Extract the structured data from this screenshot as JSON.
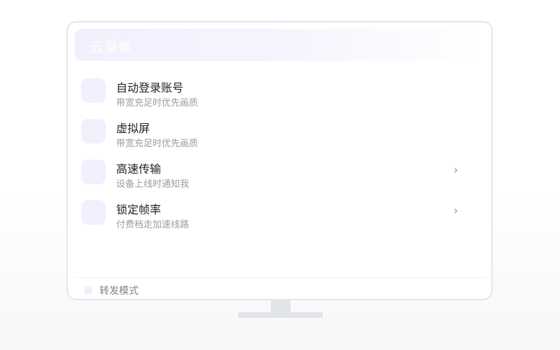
{
  "header": {
    "title": "云录像"
  },
  "settings": {
    "items": [
      {
        "title": "自动登录账号",
        "subtitle": "带宽充足时优先画质",
        "has_chevron": false
      },
      {
        "title": "虚拟屏",
        "subtitle": "带宽充足时优先画质",
        "has_chevron": false
      },
      {
        "title": "高速传输",
        "subtitle": "设备上线时通知我",
        "has_chevron": true,
        "chevron": "›"
      },
      {
        "title": "锁定帧率",
        "subtitle": "付费档走加速线路",
        "has_chevron": true,
        "chevron": "›"
      }
    ]
  },
  "footer": {
    "label": "转发模式"
  },
  "icons": {
    "item_icon": "placeholder-square-icon",
    "chevron": "chevron-right-icon",
    "footer_dot": "dot-icon"
  },
  "colors": {
    "accent_light": "#f1f0fd",
    "title_text": "#222222",
    "subtitle_text": "#9a9ca3",
    "frame": "#e4e6ea"
  }
}
